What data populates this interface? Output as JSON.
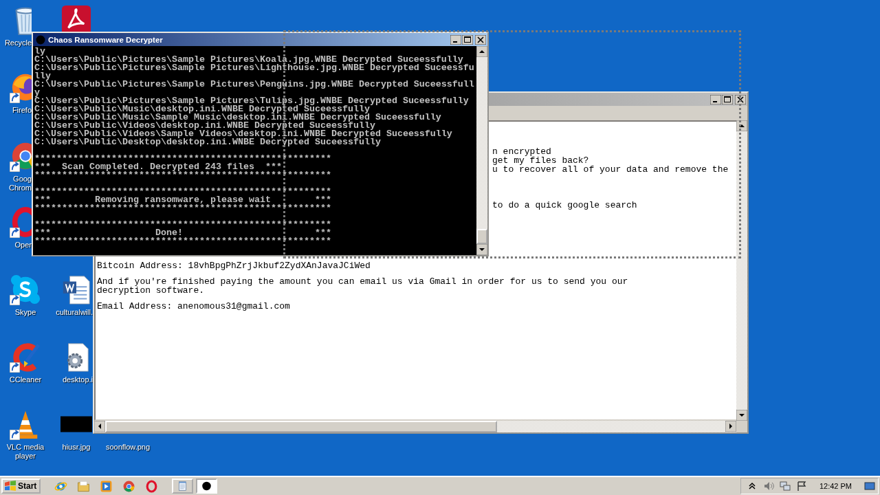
{
  "desktop_icons": [
    {
      "kind": "trash",
      "label_lines": [
        "Recycle"
      ],
      "cut": true,
      "shortcut": false
    },
    {
      "kind": "pdf",
      "cut": true,
      "shortcut": false
    },
    {
      "kind": "globe",
      "label_lines": [
        "Firefo"
      ],
      "cut": true,
      "shortcut": true
    },
    {
      "kind": "wheel",
      "label_lines": [
        "Goog",
        "Chrom"
      ],
      "cut": true,
      "shortcut": true
    },
    {
      "kind": "ring",
      "label_lines": [
        "Oper"
      ],
      "cut": true,
      "shortcut": true
    },
    {
      "kind": "bubble",
      "label_lines": [
        "Skype"
      ],
      "cut": false,
      "shortcut": true
    },
    {
      "kind": "worddoc",
      "label_lines": [
        "culturalwill."
      ],
      "cut": true,
      "shortcut": false
    },
    {
      "kind": "brush",
      "label_lines": [
        "CCleaner"
      ],
      "cut": false,
      "shortcut": true
    },
    {
      "kind": "geardoc",
      "label_lines": [
        "desktop.i"
      ],
      "cut": true,
      "shortcut": false
    },
    {
      "kind": "cone",
      "label_lines": [
        "VLC media",
        "player"
      ],
      "cut": false,
      "shortcut": true
    },
    {
      "kind": "thumbnail",
      "label_lines": [
        "hiusr.jpg"
      ],
      "cut": false,
      "shortcut": false
    },
    {
      "kind": "blank",
      "label_lines": [
        "soonflow.png"
      ],
      "cut": false
    }
  ],
  "notepad": {
    "paragraphs": [
      {
        "covered": true,
        "lines": [
          "n encrypted",
          "get my files back?",
          "u to recover all of your data and remove the"
        ]
      },
      {
        "covered": true,
        "lines": [
          "to do a quick google search"
        ]
      },
      {
        "covered": false,
        "lines": [
          "Bitcoin Address: 18vhBpgPhZrjJkbuf2ZydXAnJavaJCiWed"
        ]
      },
      {
        "covered": false,
        "lines": [
          "And if you're finished paying the amount you can email us via Gmail in order for us to send you our",
          "decryption software."
        ]
      },
      {
        "covered": false,
        "lines": [
          "Email Address: anenomous31@gmail.com"
        ]
      }
    ]
  },
  "console": {
    "title": "Chaos Ransomware Decrypter",
    "log_lines": [
      "ly",
      "C:\\Users\\Public\\Pictures\\Sample Pictures\\Koala.jpg.WNBE Decrypted Suceessfully",
      "C:\\Users\\Public\\Pictures\\Sample Pictures\\Lighthouse.jpg.WNBE Decrypted Suceessfu",
      "lly",
      "C:\\Users\\Public\\Pictures\\Sample Pictures\\Penguins.jpg.WNBE Decrypted Suceessfull",
      "y",
      "C:\\Users\\Public\\Pictures\\Sample Pictures\\Tulips.jpg.WNBE Decrypted Suceessfully",
      "C:\\Users\\Public\\Music\\desktop.ini.WNBE Decrypted Suceessfully",
      "C:\\Users\\Public\\Music\\Sample Music\\desktop.ini.WNBE Decrypted Suceessfully",
      "C:\\Users\\Public\\Videos\\desktop.ini.WNBE Decrypted Suceessfully",
      "C:\\Users\\Public\\Videos\\Sample Videos\\desktop.ini.WNBE Decrypted Suceessfully",
      "C:\\Users\\Public\\Desktop\\desktop.ini.WNBE Decrypted Suceessfully"
    ],
    "banners": [
      {
        "lines": [
          "******************************************************",
          "***  Scan Completed. Decrypted 243 files  ***",
          "******************************************************"
        ]
      },
      {
        "lines": [
          "******************************************************",
          "***        Removing ransomware, please wait        ***",
          "******************************************************"
        ]
      },
      {
        "lines": [
          "******************************************************",
          "***                   Done!                        ***",
          "******************************************************"
        ]
      }
    ]
  },
  "taskbar": {
    "start_label": "Start",
    "quick_launch": [
      {
        "kind": "ie"
      },
      {
        "kind": "folder"
      },
      {
        "kind": "media"
      },
      {
        "kind": "wheel"
      },
      {
        "kind": "ring"
      }
    ],
    "tasks": [
      {
        "kind": "notepad",
        "selected": false
      },
      {
        "kind": "chaos",
        "selected": true
      }
    ],
    "clock": "12:42 PM"
  }
}
